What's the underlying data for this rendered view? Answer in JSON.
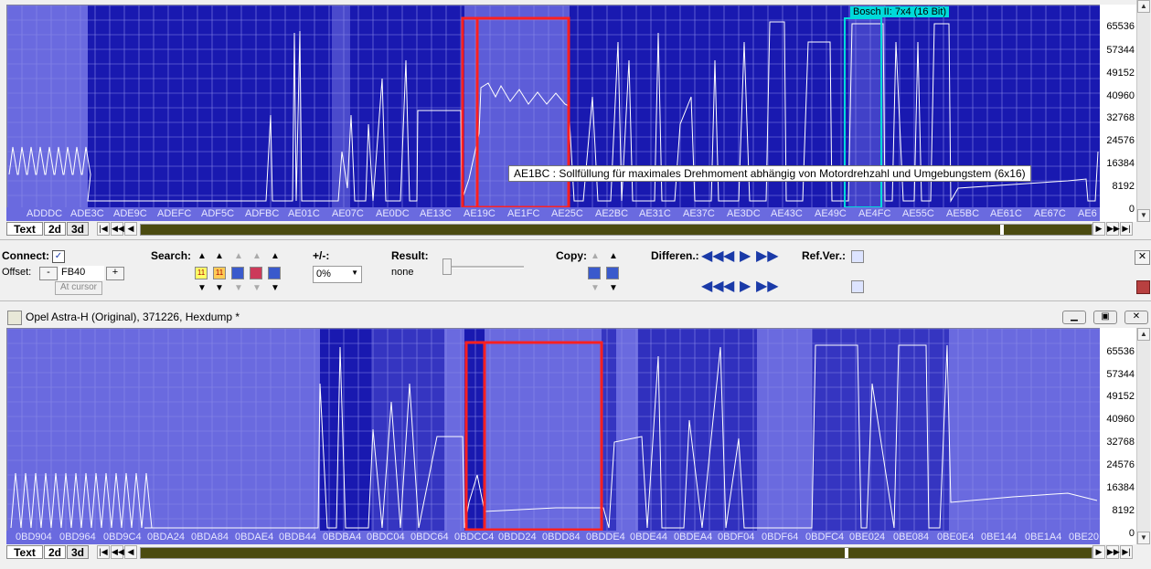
{
  "top_panel": {
    "x_labels": [
      "ADDDC",
      "ADE3C",
      "ADE9C",
      "ADEFC",
      "ADF5C",
      "ADFBC",
      "AE01C",
      "AE07C",
      "AE0DC",
      "AE13C",
      "AE19C",
      "AE1FC",
      "AE25C",
      "AE2BC",
      "AE31C",
      "AE37C",
      "AE3DC",
      "AE43C",
      "AE49C",
      "AE4FC",
      "AE55C",
      "AE5BC",
      "AE61C",
      "AE67C",
      "AE6"
    ],
    "y_ticks": [
      "65536",
      "57344",
      "49152",
      "40960",
      "32768",
      "24576",
      "16384",
      "8192",
      "0"
    ],
    "tooltip": "AE1BC : Sollfüllung für maximales Drehmoment abhängig von Motordrehzahl und Umgebungstem (6x16)",
    "map_tag": "Bosch II: 7x4 (16 Bit)",
    "tabs": [
      "Text",
      "2d",
      "3d"
    ]
  },
  "toolbar": {
    "connect_label": "Connect:",
    "offset_label": "Offset:",
    "offset_value": "FB40",
    "minus_label": "-",
    "plus_label": "+",
    "at_cursor_label": "At cursor",
    "search_label": "Search:",
    "plusminus_label": "+/-:",
    "plusminus_value": "0%",
    "result_label": "Result:",
    "result_value": "none",
    "copy_label": "Copy:",
    "differen_label": "Differen.:",
    "refver_label": "Ref.Ver.:",
    "search_btn_text_1": "11",
    "search_btn_text_2": "11"
  },
  "bottom_window": {
    "title": "Opel Astra-H (Original), 371226, Hexdump *"
  },
  "bottom_panel": {
    "x_labels": [
      "0BD904",
      "0BD964",
      "0BD9C4",
      "0BDA24",
      "0BDA84",
      "0BDAE4",
      "0BDB44",
      "0BDBA4",
      "0BDC04",
      "0BDC64",
      "0BDCC4",
      "0BDD24",
      "0BDD84",
      "0BDDE4",
      "0BDE44",
      "0BDEA4",
      "0BDF04",
      "0BDF64",
      "0BDFC4",
      "0BE024",
      "0BE084",
      "0BE0E4",
      "0BE144",
      "0BE1A4",
      "0BE20"
    ],
    "y_ticks": [
      "65536",
      "57344",
      "49152",
      "40960",
      "32768",
      "24576",
      "16384",
      "8192",
      "0"
    ],
    "tabs": [
      "Text",
      "2d",
      "3d"
    ]
  },
  "colors": {
    "plot_background": "#6a6adf",
    "plot_dark": "#0a0aa8",
    "selection": "#ff2020",
    "map_tag": "#00dada",
    "line": "#ffffff"
  }
}
